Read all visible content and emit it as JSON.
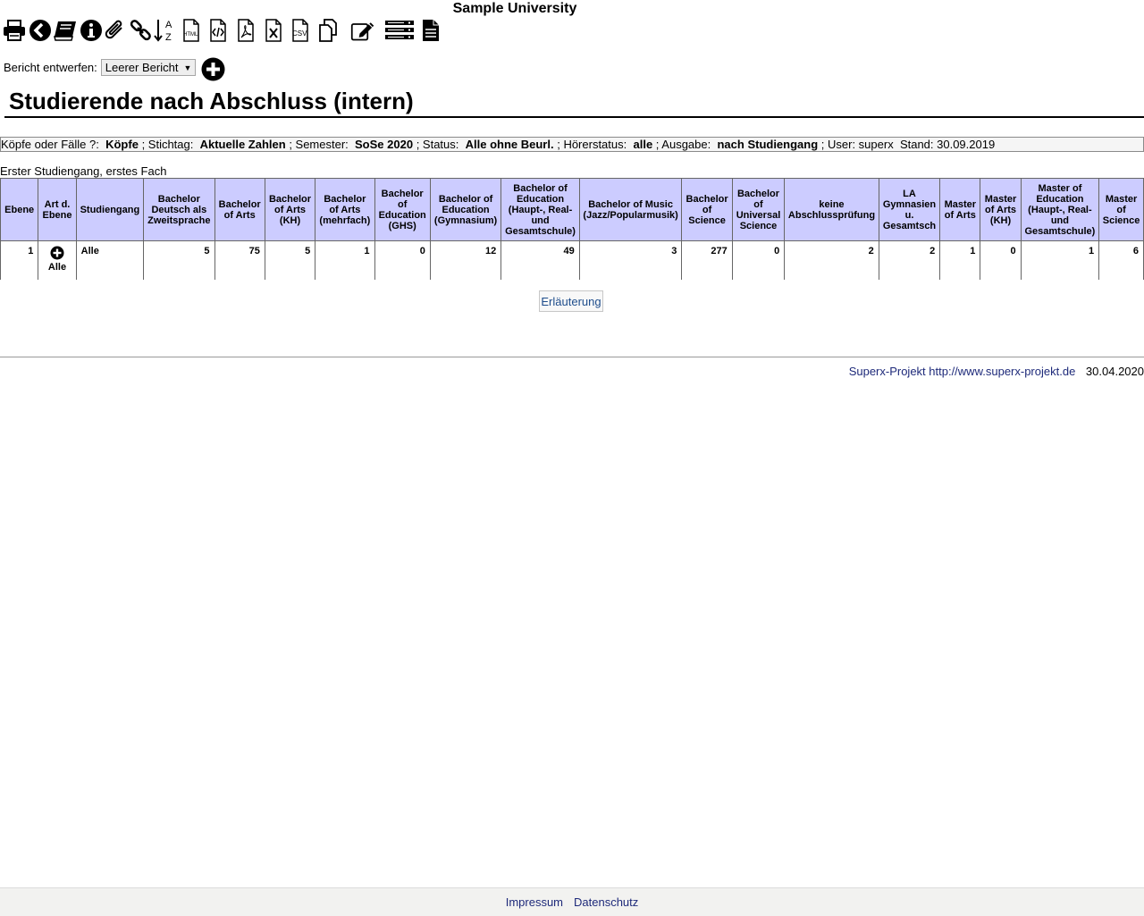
{
  "header": {
    "university": "Sample University"
  },
  "toolbar": {
    "icons": [
      "print-icon",
      "back-icon",
      "books-icon",
      "info-icon",
      "paperclip-icon",
      "link-icon",
      "sort-az-icon",
      "html-export-icon",
      "xml-export-icon",
      "pdf-export-icon",
      "excel-export-icon",
      "csv-export-icon",
      "copy-icon",
      "edit-icon",
      "list-icon",
      "document-icon"
    ],
    "html_label": "HTML",
    "csv_label": "CSV",
    "az_a": "A",
    "az_z": "Z"
  },
  "designer": {
    "label": "Bericht entwerfen:",
    "selected": "Leerer Bericht"
  },
  "report": {
    "title": "Studierende nach Abschluss (intern)"
  },
  "params": {
    "k1": "Köpfe oder Fälle ?:",
    "v1": "Köpfe",
    "k2": "; Stichtag:",
    "v2": "Aktuelle Zahlen",
    "k3": "; Semester:",
    "v3": "SoSe 2020",
    "k4": "; Status:",
    "v4": "Alle ohne Beurl.",
    "k5": "; Hörerstatus:",
    "v5": "alle",
    "k6": "; Ausgabe:",
    "v6": "nach Studiengang",
    "k7": "; User: superx",
    "k8": "Stand: 30.09.2019"
  },
  "table": {
    "caption": "Erster Studiengang, erstes Fach",
    "headers": [
      "Ebene",
      "Art d. Ebene",
      "Studiengang",
      "Bachelor Deutsch als Zweitsprache",
      "Bachelor of Arts",
      "Bachelor of Arts (KH)",
      "Bachelor of Arts (mehrfach)",
      "Bachelor of Education (GHS)",
      "Bachelor of Education (Gymnasium)",
      "Bachelor of Education (Haupt-, Real- und Gesamtschule)",
      "Bachelor of Music (Jazz/Popularmusik)",
      "Bachelor of Science",
      "Bachelor of Universal Science",
      "keine Abschlussprüfung",
      "LA Gymnasien u. Gesamtsch",
      "Master of Arts",
      "Master of Arts (KH)",
      "Master of Education (Haupt-, Real- und Gesamtschule)",
      "Master of Science"
    ],
    "row": {
      "ebene": "1",
      "art": "Alle",
      "studiengang": "Alle",
      "values": [
        "5",
        "75",
        "5",
        "1",
        "0",
        "12",
        "49",
        "3",
        "277",
        "0",
        "2",
        "2",
        "1",
        "0",
        "1",
        "6"
      ]
    }
  },
  "buttons": {
    "explain": "Erläuterung"
  },
  "footer": {
    "project": "Superx-Projekt http://www.superx-projekt.de",
    "date": "30.04.2020",
    "impressum": "Impressum",
    "datenschutz": "Datenschutz"
  },
  "colors": {
    "header_bg": "#ccccff",
    "link": "#1e2a7a"
  }
}
